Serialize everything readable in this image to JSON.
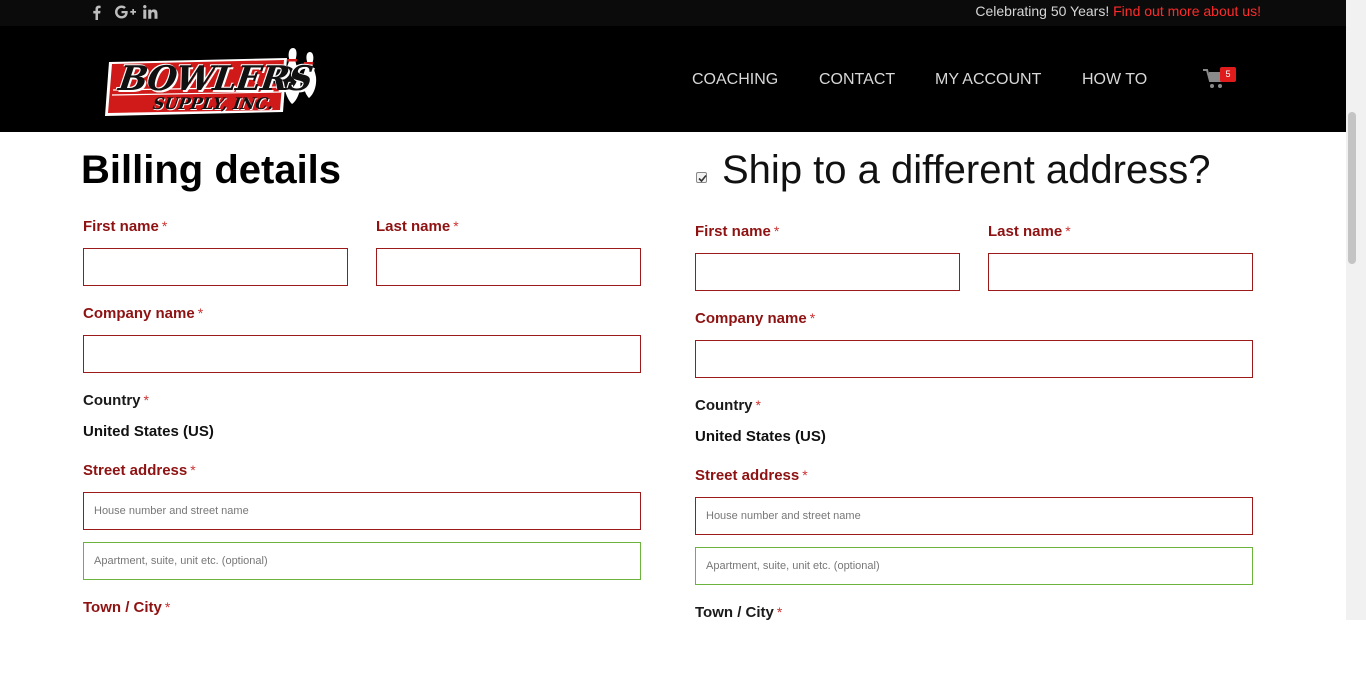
{
  "topbar": {
    "social": [
      {
        "icon": "facebook-icon",
        "glyph": "f"
      },
      {
        "icon": "google-plus-icon",
        "glyph": "G+"
      },
      {
        "icon": "linkedin-icon",
        "glyph": "in"
      }
    ],
    "announcement_text": "Celebrating 50 Years! ",
    "announcement_link": "Find out more about us!"
  },
  "header": {
    "logo_line1": "BOWLERS",
    "logo_line2": "SUPPLY, INC.",
    "nav": [
      {
        "label": "COACHING"
      },
      {
        "label": "CONTACT"
      },
      {
        "label": "MY ACCOUNT"
      },
      {
        "label": "HOW TO"
      }
    ],
    "cart_count": "5"
  },
  "billing": {
    "title": "Billing details",
    "first_name_label": "First name",
    "last_name_label": "Last name",
    "company_label": "Company name",
    "country_label": "Country",
    "country_value": "United States (US)",
    "street_label": "Street address",
    "street_placeholder": "House number and street name",
    "apt_placeholder": "Apartment, suite, unit etc. (optional)",
    "town_label": "Town / City",
    "required_mark": "*"
  },
  "shipping": {
    "title": "Ship to a different address?",
    "checked": true,
    "first_name_label": "First name",
    "last_name_label": "Last name",
    "company_label": "Company name",
    "country_label": "Country",
    "country_value": "United States (US)",
    "street_label": "Street address",
    "street_placeholder": "House number and street name",
    "apt_placeholder": "Apartment, suite, unit etc. (optional)",
    "town_label": "Town / City",
    "required_mark": "*"
  },
  "colors": {
    "label_red": "#8e1212",
    "input_border_red": "#9c1a1a",
    "input_border_green": "#6cb33e",
    "accent_link": "#ff2b2b"
  }
}
